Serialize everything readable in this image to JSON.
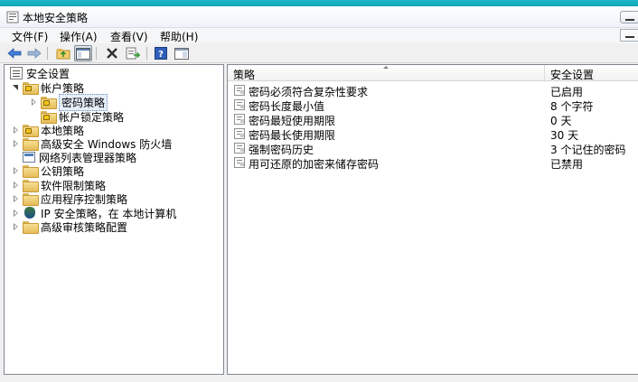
{
  "window": {
    "title": "本地安全策略",
    "icon": "security-policy-icon"
  },
  "menubar": {
    "items": [
      "文件(F)",
      "操作(A)",
      "查看(V)",
      "帮助(H)"
    ]
  },
  "toolbar": {
    "buttons": [
      "back-icon",
      "forward-icon",
      "up-folder-icon",
      "show-tree-icon",
      "delete-icon",
      "export-list-icon",
      "help-icon",
      "properties-pane-icon"
    ]
  },
  "tree": {
    "root": "安全设置",
    "items": [
      {
        "label": "帐户策略",
        "state": "expanded"
      },
      {
        "label": "密码策略",
        "state": "selected"
      },
      {
        "label": "帐户锁定策略",
        "state": "leaf"
      },
      {
        "label": "本地策略",
        "state": "collapsed"
      },
      {
        "label": "高级安全 Windows 防火墙",
        "state": "collapsed"
      },
      {
        "label": "网络列表管理器策略",
        "state": "leaf"
      },
      {
        "label": "公钥策略",
        "state": "collapsed"
      },
      {
        "label": "软件限制策略",
        "state": "collapsed"
      },
      {
        "label": "应用程序控制策略",
        "state": "collapsed"
      },
      {
        "label": "IP 安全策略，在 本地计算机",
        "state": "collapsed"
      },
      {
        "label": "高级审核策略配置",
        "state": "collapsed"
      }
    ]
  },
  "list": {
    "columns": [
      "策略",
      "安全设置"
    ],
    "rows": [
      {
        "policy": "密码必须符合复杂性要求",
        "setting": "已启用"
      },
      {
        "policy": "密码长度最小值",
        "setting": "8 个字符"
      },
      {
        "policy": "密码最短使用期限",
        "setting": "0 天"
      },
      {
        "policy": "密码最长使用期限",
        "setting": "30 天"
      },
      {
        "policy": "强制密码历史",
        "setting": "3 个记住的密码"
      },
      {
        "policy": "用可还原的加密来储存密码",
        "setting": "已禁用"
      }
    ]
  },
  "colors": {
    "accent_strip": "#1fb5c6",
    "selection_bg": "#e6eefa"
  }
}
